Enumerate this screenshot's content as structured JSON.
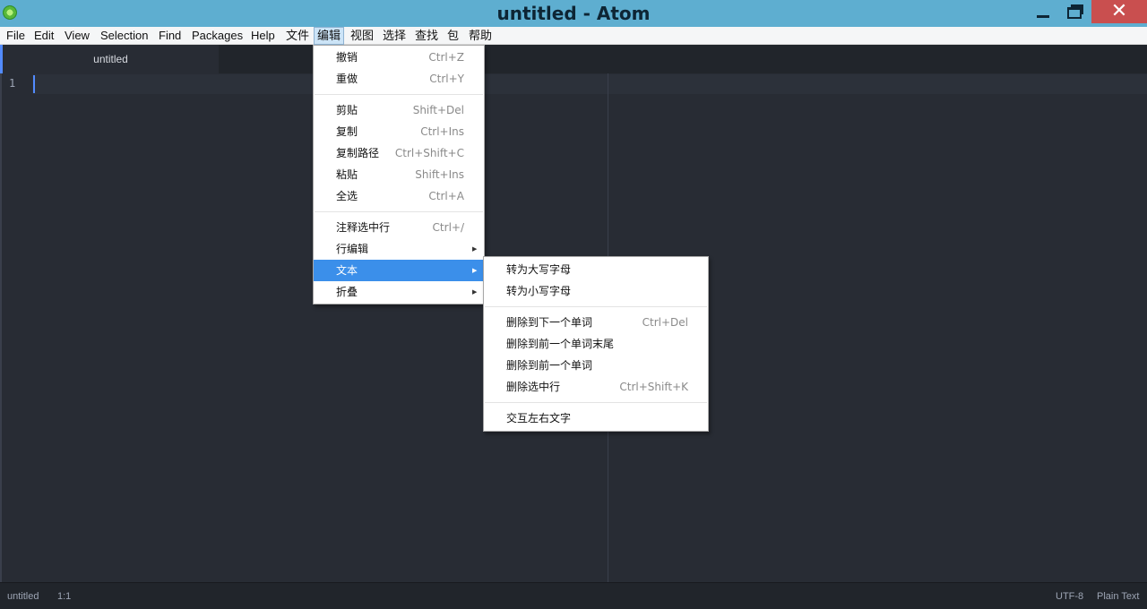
{
  "window": {
    "title": "untitled - Atom",
    "minimize_icon": "minimize-icon",
    "maximize_icon": "restore-icon",
    "close_glyph": "✕"
  },
  "menubar": {
    "items": [
      "File",
      "Edit",
      "View",
      "Selection",
      "Find",
      "Packages",
      "Help",
      "文件",
      "编辑",
      "视图",
      "选择",
      "查找",
      "包",
      "帮助"
    ],
    "active": "编辑"
  },
  "tabs": [
    {
      "label": "untitled"
    }
  ],
  "editor": {
    "line_number": "1"
  },
  "statusbar": {
    "file": "untitled",
    "cursor": "1:1",
    "encoding": "UTF-8",
    "grammar": "Plain Text"
  },
  "edit_menu": {
    "items": [
      {
        "label": "撤销",
        "shortcut": "Ctrl+Z"
      },
      {
        "label": "重做",
        "shortcut": "Ctrl+Y"
      },
      {
        "label": "剪贴",
        "shortcut": "Shift+Del"
      },
      {
        "label": "复制",
        "shortcut": "Ctrl+Ins"
      },
      {
        "label": "复制路径",
        "shortcut": "Ctrl+Shift+C"
      },
      {
        "label": "粘贴",
        "shortcut": "Shift+Ins"
      },
      {
        "label": "全选",
        "shortcut": "Ctrl+A"
      },
      {
        "label": "注释选中行",
        "shortcut": "Ctrl+/"
      },
      {
        "label": "行编辑",
        "shortcut": ""
      },
      {
        "label": "文本",
        "shortcut": ""
      },
      {
        "label": "折叠",
        "shortcut": ""
      }
    ]
  },
  "text_submenu": {
    "items": [
      {
        "label": "转为大写字母",
        "shortcut": ""
      },
      {
        "label": "转为小写字母",
        "shortcut": ""
      },
      {
        "label": "删除到下一个单词",
        "shortcut": "Ctrl+Del"
      },
      {
        "label": "删除到前一个单词末尾",
        "shortcut": ""
      },
      {
        "label": "删除到前一个单词",
        "shortcut": ""
      },
      {
        "label": "删除选中行",
        "shortcut": "Ctrl+Shift+K"
      },
      {
        "label": "交互左右文字",
        "shortcut": ""
      }
    ]
  },
  "colors": {
    "titlebar": "#5eaed0",
    "editor_bg": "#282c34",
    "accent": "#528bff",
    "menu_highlight": "#3b8fea",
    "close_button": "#c94f4f"
  }
}
